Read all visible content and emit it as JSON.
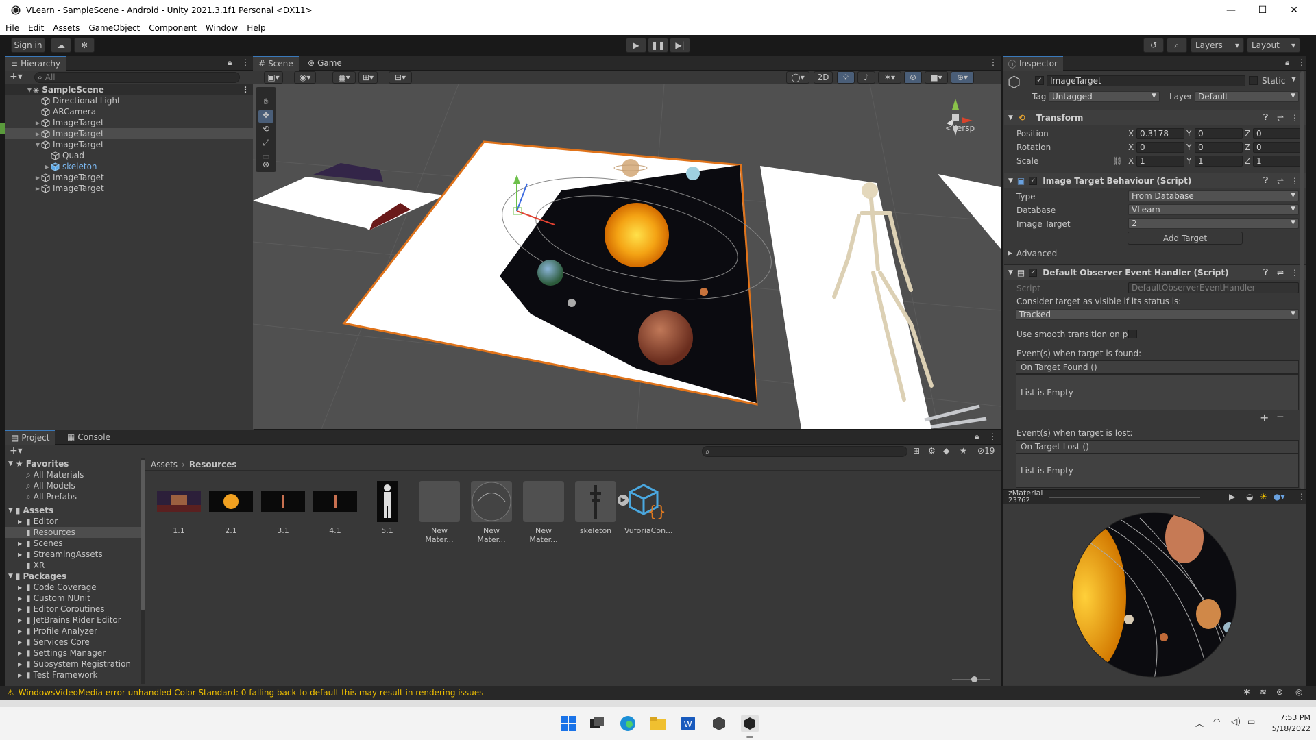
{
  "window": {
    "title": "VLearn - SampleScene - Android - Unity 2021.3.1f1 Personal <DX11>"
  },
  "menu": [
    "File",
    "Edit",
    "Assets",
    "GameObject",
    "Component",
    "Window",
    "Help"
  ],
  "toolbar": {
    "signin": "Sign in",
    "layers": "Layers",
    "layout": "Layout"
  },
  "hierarchy": {
    "tab": "Hierarchy",
    "search_placeholder": "All",
    "scene": "SampleScene",
    "items": [
      {
        "label": "Directional Light",
        "indent": 1,
        "arrow": false
      },
      {
        "label": "ARCamera",
        "indent": 1,
        "arrow": false
      },
      {
        "label": "ImageTarget",
        "indent": 1,
        "arrow": "right"
      },
      {
        "label": "ImageTarget",
        "indent": 1,
        "arrow": "right",
        "selected": true
      },
      {
        "label": "ImageTarget",
        "indent": 1,
        "arrow": "down"
      },
      {
        "label": "Quad",
        "indent": 2,
        "arrow": false
      },
      {
        "label": "skeleton",
        "indent": 2,
        "arrow": "right",
        "prefab": true
      },
      {
        "label": "ImageTarget",
        "indent": 1,
        "arrow": "right"
      },
      {
        "label": "ImageTarget",
        "indent": 1,
        "arrow": "right"
      }
    ]
  },
  "scene": {
    "tabs": [
      "Scene",
      "Game"
    ],
    "mode2d": "2D",
    "persp": "Persp"
  },
  "inspector": {
    "tab": "Inspector",
    "object_name": "ImageTarget",
    "static": "Static",
    "tag_label": "Tag",
    "tag": "Untagged",
    "layer_label": "Layer",
    "layer": "Default",
    "transform": {
      "title": "Transform",
      "position": [
        "0.3178",
        "0",
        "0"
      ],
      "rotation": [
        "0",
        "0",
        "0"
      ],
      "scale": [
        "1",
        "1",
        "1"
      ],
      "labels": [
        "Position",
        "Rotation",
        "Scale"
      ]
    },
    "itb": {
      "title": "Image Target Behaviour (Script)",
      "type_label": "Type",
      "type": "From Database",
      "database_label": "Database",
      "database": "VLearn",
      "target_label": "Image Target",
      "target": "2",
      "add_target": "Add Target",
      "advanced": "Advanced"
    },
    "doeh": {
      "title": "Default Observer Event Handler (Script)",
      "script_label": "Script",
      "script": "DefaultObserverEventHandler",
      "consider": "Consider target as visible if its status is:",
      "status": "Tracked",
      "smooth": "Use smooth transition on pos",
      "found_label": "Event(s) when target is found:",
      "found_event": "On Target Found ()",
      "empty": "List is Empty",
      "lost_label": "Event(s) when target is lost:",
      "lost_event": "On Target Lost ()"
    },
    "preview_title": "zMaterial",
    "preview_sub": "23762"
  },
  "project": {
    "tabs": [
      "Project",
      "Console"
    ],
    "favorites": {
      "title": "Favorites",
      "items": [
        "All Materials",
        "All Models",
        "All Prefabs"
      ]
    },
    "assets": {
      "title": "Assets",
      "items": [
        "Editor",
        "Resources",
        "Scenes",
        "StreamingAssets",
        "XR"
      ]
    },
    "packages": {
      "title": "Packages",
      "items": [
        "Code Coverage",
        "Custom NUnit",
        "Editor Coroutines",
        "JetBrains Rider Editor",
        "Profile Analyzer",
        "Services Core",
        "Settings Manager",
        "Subsystem Registration",
        "Test Framework"
      ]
    },
    "breadcrumb": [
      "Assets",
      "Resources"
    ],
    "hidden_count": "19",
    "files": [
      "1.1",
      "2.1",
      "3.1",
      "4.1",
      "5.1",
      "New Mater...",
      "New Mater...",
      "New Mater...",
      "skeleton",
      "VuforiaCon..."
    ]
  },
  "status": {
    "message": "WindowsVideoMedia error unhandled Color Standard: 0  falling back to default this may result in rendering issues"
  },
  "taskbar": {
    "time": "7:53 PM",
    "date": "5/18/2022"
  },
  "colors": {
    "selection": "#3a79bb",
    "bg": "#383838",
    "warning": "#f0c000"
  }
}
